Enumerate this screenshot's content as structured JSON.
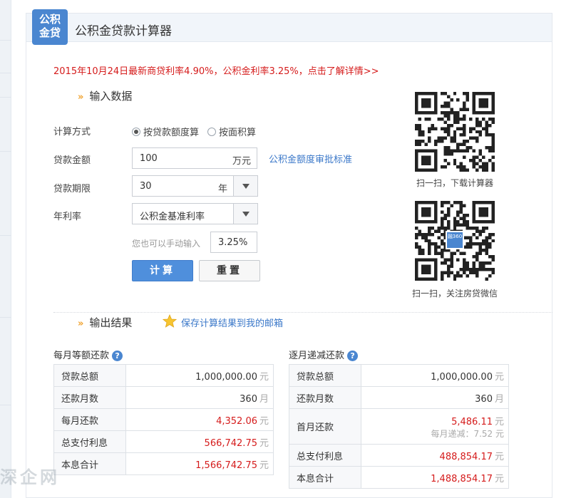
{
  "header": {
    "badge": "公积\n金贷",
    "badge_line1": "公积",
    "badge_line2": "金贷",
    "title": "公积金贷款计算器"
  },
  "notice": "2015年10月24日最新商贷利率4.90%，公积金利率3.25%，点击了解详情>>",
  "input_section": {
    "arrows": "»",
    "title": "输入数据",
    "method_label": "计算方式",
    "method_options": [
      "按贷款额度算",
      "按面积算"
    ],
    "method_selected": "按贷款额度算",
    "amount_label": "贷款金额",
    "amount_value": "100",
    "amount_unit": "万元",
    "amount_link": "公积金额度审批标准",
    "term_label": "贷款期限",
    "term_value": "30",
    "term_unit": "年",
    "rate_label": "年利率",
    "rate_select": "公积金基准利率",
    "manual_hint": "您也可以手动输入",
    "manual_rate": "3.25%",
    "calc_button": "计算",
    "reset_button": "重置"
  },
  "qr": {
    "caption1": "扫一扫，下载计算器",
    "caption2": "扫一扫，关注房贷微信",
    "center_text": "融360"
  },
  "output_section": {
    "arrows": "»",
    "title": "输出结果",
    "save_link": "保存计算结果到我的邮箱"
  },
  "equal_payment": {
    "title": "每月等额还款",
    "help": "?",
    "rows": [
      {
        "key": "贷款总额",
        "value": "1,000,000.00",
        "unit": "元",
        "red": false
      },
      {
        "key": "还款月数",
        "value": "360",
        "unit": "月",
        "red": false
      },
      {
        "key": "每月还款",
        "value": "4,352.06",
        "unit": "元",
        "red": true
      },
      {
        "key": "总支付利息",
        "value": "566,742.75",
        "unit": "元",
        "red": true
      },
      {
        "key": "本息合计",
        "value": "1,566,742.75",
        "unit": "元",
        "red": true
      }
    ]
  },
  "decreasing_payment": {
    "title": "逐月递减还款",
    "help": "?",
    "rows": [
      {
        "key": "贷款总额",
        "value": "1,000,000.00",
        "unit": "元",
        "red": false
      },
      {
        "key": "还款月数",
        "value": "360",
        "unit": "月",
        "red": false
      },
      {
        "key": "首月还款",
        "value": "5,486.11",
        "unit": "元",
        "red": true,
        "sub": "每月递减：7.52 元"
      },
      {
        "key": "总支付利息",
        "value": "488,854.17",
        "unit": "元",
        "red": true
      },
      {
        "key": "本息合计",
        "value": "1,488,854.17",
        "unit": "元",
        "red": true
      }
    ]
  },
  "colors": {
    "accent": "#4a86d0",
    "notice_red": "#d51b1b",
    "link_blue": "#3b78c9",
    "arrow_orange": "#f0a22e"
  }
}
